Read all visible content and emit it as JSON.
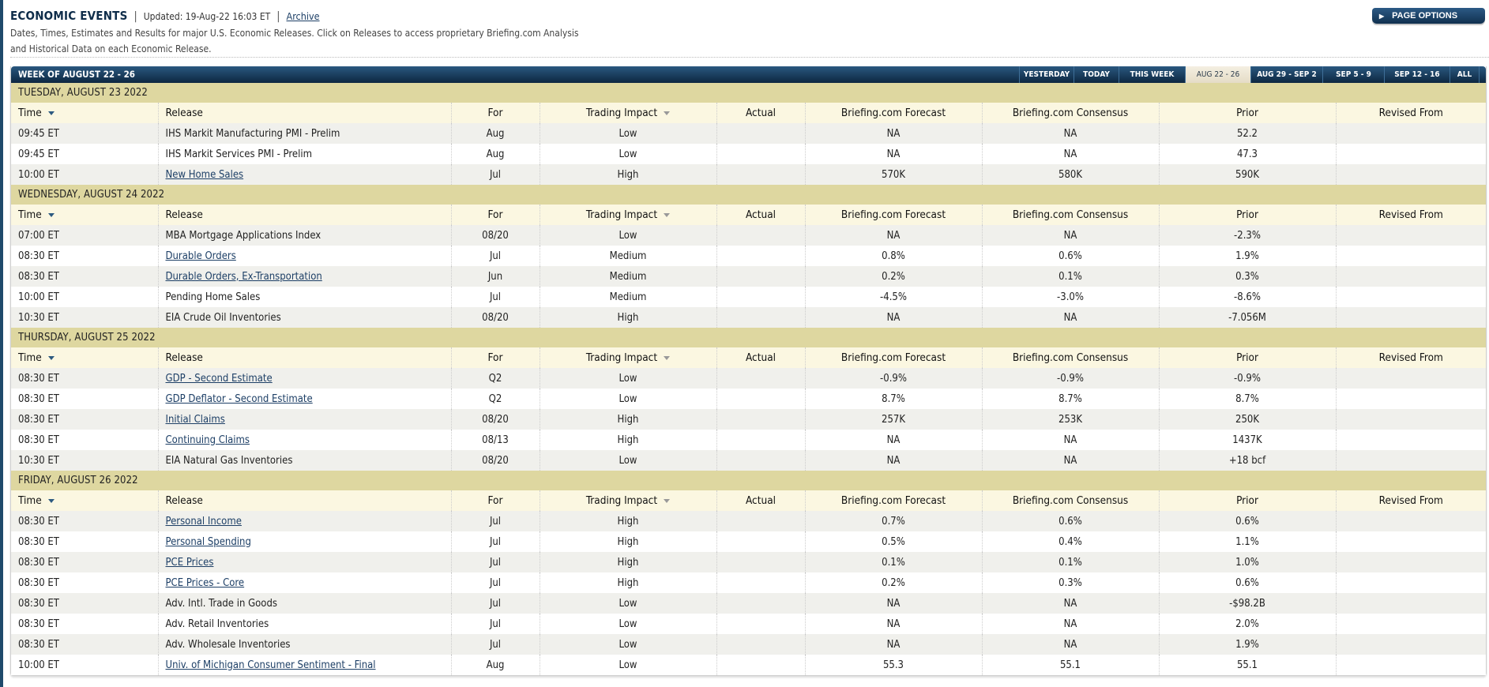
{
  "header": {
    "title": "ECONOMIC EVENTS",
    "separator": "|",
    "updated": "Updated: 19-Aug-22 16:03 ET",
    "archive_label": "Archive",
    "description_line1": "Dates, Times, Estimates and Results for major U.S. Economic Releases. Click on Releases to access proprietary Briefing.com Analysis",
    "description_line2": "and Historical Data on each Economic Release."
  },
  "page_options": {
    "icon": "play-triangle-icon",
    "label": "PAGE OPTIONS"
  },
  "week_bar": {
    "title": "WEEK OF AUGUST 22 - 26",
    "tabs": [
      {
        "label": "YESTERDAY",
        "active": false
      },
      {
        "label": "TODAY",
        "active": false
      },
      {
        "label": "THIS WEEK",
        "active": false
      },
      {
        "label": "AUG 22 - 26",
        "active": true
      },
      {
        "label": "AUG 29 - SEP 2",
        "active": false
      },
      {
        "label": "SEP 5 - 9",
        "active": false
      },
      {
        "label": "SEP 12 - 16",
        "active": false
      },
      {
        "label": "ALL",
        "active": false
      }
    ]
  },
  "columns": {
    "time": "Time",
    "release": "Release",
    "for": "For",
    "impact": "Trading Impact",
    "actual": "Actual",
    "forecast": "Briefing.com Forecast",
    "consensus": "Briefing.com Consensus",
    "prior": "Prior",
    "revised": "Revised From"
  },
  "days": [
    {
      "label": "TUESDAY, AUGUST 23 2022",
      "rows": [
        {
          "time": "09:45 ET",
          "release": "IHS Markit Manufacturing PMI - Prelim",
          "link": false,
          "for": "Aug",
          "impact": "Low",
          "actual": "",
          "forecast": "NA",
          "consensus": "NA",
          "prior": "52.2",
          "revised": ""
        },
        {
          "time": "09:45 ET",
          "release": "IHS Markit Services PMI - Prelim",
          "link": false,
          "for": "Aug",
          "impact": "Low",
          "actual": "",
          "forecast": "NA",
          "consensus": "NA",
          "prior": "47.3",
          "revised": ""
        },
        {
          "time": "10:00 ET",
          "release": "New Home Sales",
          "link": true,
          "for": "Jul",
          "impact": "High",
          "actual": "",
          "forecast": "570K",
          "consensus": "580K",
          "prior": "590K",
          "revised": ""
        }
      ]
    },
    {
      "label": "WEDNESDAY, AUGUST 24 2022",
      "rows": [
        {
          "time": "07:00 ET",
          "release": "MBA Mortgage Applications Index",
          "link": false,
          "for": "08/20",
          "impact": "Low",
          "actual": "",
          "forecast": "NA",
          "consensus": "NA",
          "prior": "-2.3%",
          "revised": ""
        },
        {
          "time": "08:30 ET",
          "release": "Durable Orders",
          "link": true,
          "for": "Jul",
          "impact": "Medium",
          "actual": "",
          "forecast": "0.8%",
          "consensus": "0.6%",
          "prior": "1.9%",
          "revised": ""
        },
        {
          "time": "08:30 ET",
          "release": "Durable Orders, Ex-Transportation",
          "link": true,
          "for": "Jun",
          "impact": "Medium",
          "actual": "",
          "forecast": "0.2%",
          "consensus": "0.1%",
          "prior": "0.3%",
          "revised": ""
        },
        {
          "time": "10:00 ET",
          "release": "Pending Home Sales",
          "link": false,
          "for": "Jul",
          "impact": "Medium",
          "actual": "",
          "forecast": "-4.5%",
          "consensus": "-3.0%",
          "prior": "-8.6%",
          "revised": ""
        },
        {
          "time": "10:30 ET",
          "release": "EIA Crude Oil Inventories",
          "link": false,
          "for": "08/20",
          "impact": "High",
          "actual": "",
          "forecast": "NA",
          "consensus": "NA",
          "prior": "-7.056M",
          "revised": ""
        }
      ]
    },
    {
      "label": "THURSDAY, AUGUST 25 2022",
      "rows": [
        {
          "time": "08:30 ET",
          "release": "GDP - Second Estimate",
          "link": true,
          "for": "Q2",
          "impact": "Low",
          "actual": "",
          "forecast": "-0.9%",
          "consensus": "-0.9%",
          "prior": "-0.9%",
          "revised": ""
        },
        {
          "time": "08:30 ET",
          "release": "GDP Deflator - Second Estimate",
          "link": true,
          "for": "Q2",
          "impact": "Low",
          "actual": "",
          "forecast": "8.7%",
          "consensus": "8.7%",
          "prior": "8.7%",
          "revised": ""
        },
        {
          "time": "08:30 ET",
          "release": "Initial Claims",
          "link": true,
          "for": "08/20",
          "impact": "High",
          "actual": "",
          "forecast": "257K",
          "consensus": "253K",
          "prior": "250K",
          "revised": ""
        },
        {
          "time": "08:30 ET",
          "release": "Continuing Claims",
          "link": true,
          "for": "08/13",
          "impact": "High",
          "actual": "",
          "forecast": "NA",
          "consensus": "NA",
          "prior": "1437K",
          "revised": ""
        },
        {
          "time": "10:30 ET",
          "release": "EIA Natural Gas Inventories",
          "link": false,
          "for": "08/20",
          "impact": "Low",
          "actual": "",
          "forecast": "NA",
          "consensus": "NA",
          "prior": "+18 bcf",
          "revised": ""
        }
      ]
    },
    {
      "label": "FRIDAY, AUGUST 26 2022",
      "rows": [
        {
          "time": "08:30 ET",
          "release": "Personal Income",
          "link": true,
          "for": "Jul",
          "impact": "High",
          "actual": "",
          "forecast": "0.7%",
          "consensus": "0.6%",
          "prior": "0.6%",
          "revised": ""
        },
        {
          "time": "08:30 ET",
          "release": "Personal Spending",
          "link": true,
          "for": "Jul",
          "impact": "High",
          "actual": "",
          "forecast": "0.5%",
          "consensus": "0.4%",
          "prior": "1.1%",
          "revised": ""
        },
        {
          "time": "08:30 ET",
          "release": "PCE Prices",
          "link": true,
          "for": "Jul",
          "impact": "High",
          "actual": "",
          "forecast": "0.1%",
          "consensus": "0.1%",
          "prior": "1.0%",
          "revised": ""
        },
        {
          "time": "08:30 ET",
          "release": "PCE Prices - Core",
          "link": true,
          "for": "Jul",
          "impact": "High",
          "actual": "",
          "forecast": "0.2%",
          "consensus": "0.3%",
          "prior": "0.6%",
          "revised": ""
        },
        {
          "time": "08:30 ET",
          "release": "Adv. Intl. Trade in Goods",
          "link": false,
          "for": "Jul",
          "impact": "Low",
          "actual": "",
          "forecast": "NA",
          "consensus": "NA",
          "prior": "-$98.2B",
          "revised": ""
        },
        {
          "time": "08:30 ET",
          "release": "Adv. Retail Inventories",
          "link": false,
          "for": "Jul",
          "impact": "Low",
          "actual": "",
          "forecast": "NA",
          "consensus": "NA",
          "prior": "2.0%",
          "revised": ""
        },
        {
          "time": "08:30 ET",
          "release": "Adv. Wholesale Inventories",
          "link": false,
          "for": "Jul",
          "impact": "Low",
          "actual": "",
          "forecast": "NA",
          "consensus": "NA",
          "prior": "1.9%",
          "revised": ""
        },
        {
          "time": "10:00 ET",
          "release": "Univ. of Michigan Consumer Sentiment - Final",
          "link": true,
          "for": "Aug",
          "impact": "Low",
          "actual": "",
          "forecast": "55.3",
          "consensus": "55.1",
          "prior": "55.1",
          "revised": ""
        }
      ]
    }
  ],
  "colors": {
    "brand_navy": "#0f2d4a",
    "day_band": "#ded7a0",
    "column_header_bg": "#fbf7e1",
    "row_alt_bg": "#f0f0ec",
    "link": "#1d3f66"
  }
}
